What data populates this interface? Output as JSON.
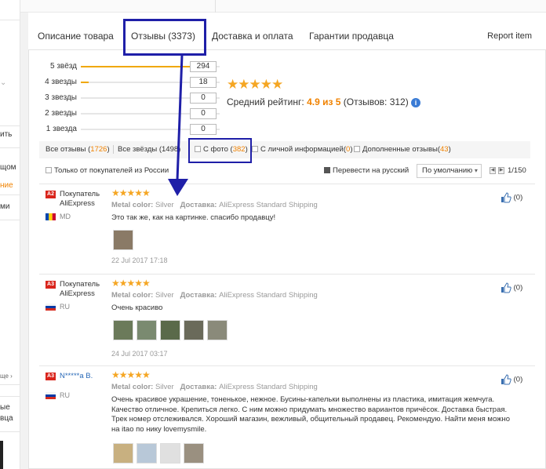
{
  "left_strip": {
    "frag1": "ить",
    "frag2": "щом",
    "frag3": "ние",
    "frag4": "ми",
    "frag5": "ще ›",
    "frag6": "ые",
    "frag7": "вца"
  },
  "tabs": {
    "description": "Описание товара",
    "reviews": "Отзывы (3373)",
    "delivery": "Доставка и оплата",
    "guarantee": "Гарантии продавца",
    "report": "Report item"
  },
  "rating": {
    "rows": [
      {
        "label": "5 звёзд",
        "count": "294",
        "fraction": 0.942
      },
      {
        "label": "4 звезды",
        "count": "18",
        "fraction": 0.058
      },
      {
        "label": "3 звезды",
        "count": "0",
        "fraction": 0
      },
      {
        "label": "2 звезды",
        "count": "0",
        "fraction": 0
      },
      {
        "label": "1 звезда",
        "count": "0",
        "fraction": 0
      }
    ],
    "stars": "★★★★★",
    "avg_label": "Средний рейтинг:",
    "avg_score": "4.9 из 5",
    "avg_count": "(Отзывов: 312)",
    "info_icon": "i"
  },
  "filters": {
    "all_label": "Все отзывы (",
    "all_count": "1726",
    "all_tail": ")",
    "all_stars": "Все звёзды (1498)",
    "photo_label": "С фото (",
    "photo_count": "382",
    "photo_tail": ")",
    "personal_label": "С личной информацией(",
    "personal_count": "0",
    "personal_tail": ")",
    "extra_label": "Дополненные отзывы(",
    "extra_count": "43",
    "extra_tail": ")",
    "russia_only": "Только от покупателей из России",
    "translate": "Перевести на русский",
    "sort": "По умолчанию",
    "sort_arrow": "▾",
    "page": "1/150"
  },
  "reviews": [
    {
      "level": "A2",
      "name_line1": "Покупатель",
      "name_line2": "AliExpress",
      "country": "MD",
      "stars": "★★★★★",
      "color_label": "Metal color:",
      "color_value": "Silver",
      "delivery_label": "Доставка:",
      "delivery_value": "AliExpress Standard Shipping",
      "text": "Это так же, как на картинке. спасибо продавцу!",
      "date": "22 Jul 2017 17:18",
      "likes": "(0)"
    },
    {
      "level": "A3",
      "name_line1": "Покупатель",
      "name_line2": "AliExpress",
      "country": "RU",
      "stars": "★★★★★",
      "color_label": "Metal color:",
      "color_value": "Silver",
      "delivery_label": "Доставка:",
      "delivery_value": "AliExpress Standard Shipping",
      "text": "Очень красиво",
      "date": "24 Jul 2017 03:17",
      "likes": "(0)"
    },
    {
      "level": "A3",
      "name_line1": "N*****a B.",
      "name_line2": "",
      "country": "RU",
      "stars": "★★★★★",
      "color_label": "Metal color:",
      "color_value": "Silver",
      "delivery_label": "Доставка:",
      "delivery_value": "AliExpress Standard Shipping",
      "text": "Очень красивое украшение, тоненькое, нежное. Бусины-капельки выполнены из пластика, имитация жемчуга. Качество отличное. Крепиться легко. С ним можно придумать множество вариантов причёсок. Доставка быстрая. Трек номер отслеживался. Хороший магазин, вежливый, общительный продавец. Рекомендую. Найти меня можно на itao по нику lovemysmile.",
      "date": "",
      "likes": "(0)"
    }
  ],
  "colors": {
    "accent_orange": "#f08200",
    "star": "#f5a623",
    "annotation_blue": "#1f1fa8",
    "link_blue": "#2a6ab8",
    "level_red": "#d9251c"
  }
}
